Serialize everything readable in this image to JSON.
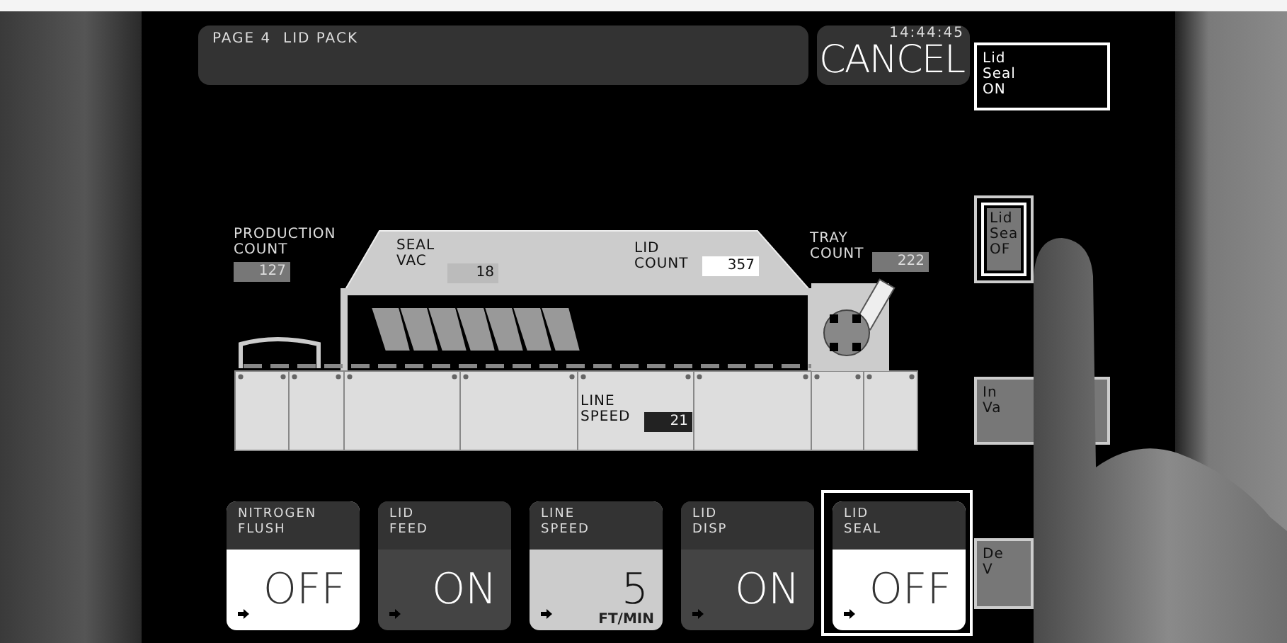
{
  "header": {
    "title": "PAGE 4  LID PACK"
  },
  "cancel": {
    "time": "14:44:45",
    "label": "CANCEL"
  },
  "side_buttons": [
    {
      "lines": [
        "Lid",
        "Seal",
        "ON"
      ],
      "kind": "outline",
      "selected": false
    },
    {
      "lines": [
        "Lid",
        "Sea",
        "OF"
      ],
      "kind": "filled",
      "selected": true
    },
    {
      "lines": [
        "In",
        "Va"
      ],
      "kind": "filled",
      "selected": false
    },
    {
      "lines": [
        "De",
        "V"
      ],
      "kind": "filled",
      "selected": false
    }
  ],
  "diagram": {
    "readouts": [
      {
        "label": [
          "PRODUCTION",
          "COUNT"
        ],
        "value": "127",
        "kind": "dark"
      },
      {
        "label": [
          "SEAL",
          "VAC"
        ],
        "value": "18",
        "kind": "light"
      },
      {
        "label": [
          "LID",
          "COUNT"
        ],
        "value": "357",
        "kind": "white"
      },
      {
        "label": [
          "TRAY",
          "COUNT"
        ],
        "value": "222",
        "kind": "dark"
      },
      {
        "label": [
          "LINE",
          "SPEED"
        ],
        "value": "21",
        "kind": "black"
      }
    ]
  },
  "tiles": [
    {
      "label": [
        "NITROGEN",
        "FLUSH"
      ],
      "kind": "toggle",
      "on": false,
      "value": "OFF",
      "selected": false
    },
    {
      "label": [
        "LID",
        "FEED"
      ],
      "kind": "toggle",
      "on": true,
      "value": "ON",
      "selected": false
    },
    {
      "label": [
        "LINE",
        "SPEED"
      ],
      "kind": "number",
      "value": "5",
      "unit": "FT/MIN",
      "selected": false
    },
    {
      "label": [
        "LID",
        "DISP"
      ],
      "kind": "toggle",
      "on": true,
      "value": "ON",
      "selected": false
    },
    {
      "label": [
        "LID",
        "SEAL"
      ],
      "kind": "toggle",
      "on": false,
      "value": "OFF",
      "selected": true
    }
  ]
}
